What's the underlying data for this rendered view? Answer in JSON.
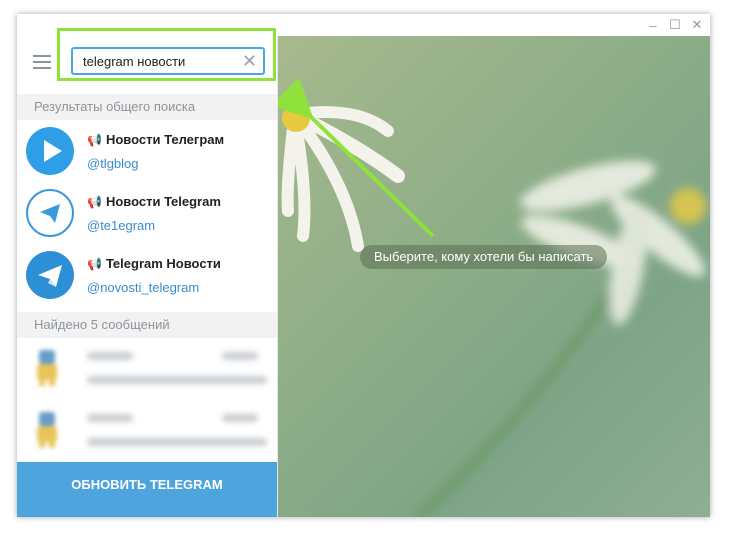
{
  "window": {
    "controls": {
      "minimize": "–",
      "maximize": "☐",
      "close": "✕"
    }
  },
  "search": {
    "value": "telegram новости",
    "clear_icon": "close-icon"
  },
  "sections": {
    "global_search": "Результаты общего поиска",
    "messages_found": "Найдено 5 сообщений"
  },
  "results": [
    {
      "name": "Новости Телеграм",
      "handle": "@tlgblog",
      "avatar_color": "#2e9ee6",
      "avatar_style": "play"
    },
    {
      "name": "Новости Telegram",
      "handle": "@te1egram",
      "avatar_color": "#ffffff",
      "avatar_style": "plane-outline"
    },
    {
      "name": "Telegram Новости",
      "handle": "@novosti_telegram",
      "avatar_color": "#2d8fd6",
      "avatar_style": "plane-filled"
    }
  ],
  "update_button": {
    "label": "ОБНОВИТЬ TELEGRAM"
  },
  "chat": {
    "placeholder": "Выберите, кому хотели бы написать"
  },
  "colors": {
    "accent": "#4ea4dd",
    "highlight": "#8fe23b",
    "link": "#3a8cd0"
  }
}
